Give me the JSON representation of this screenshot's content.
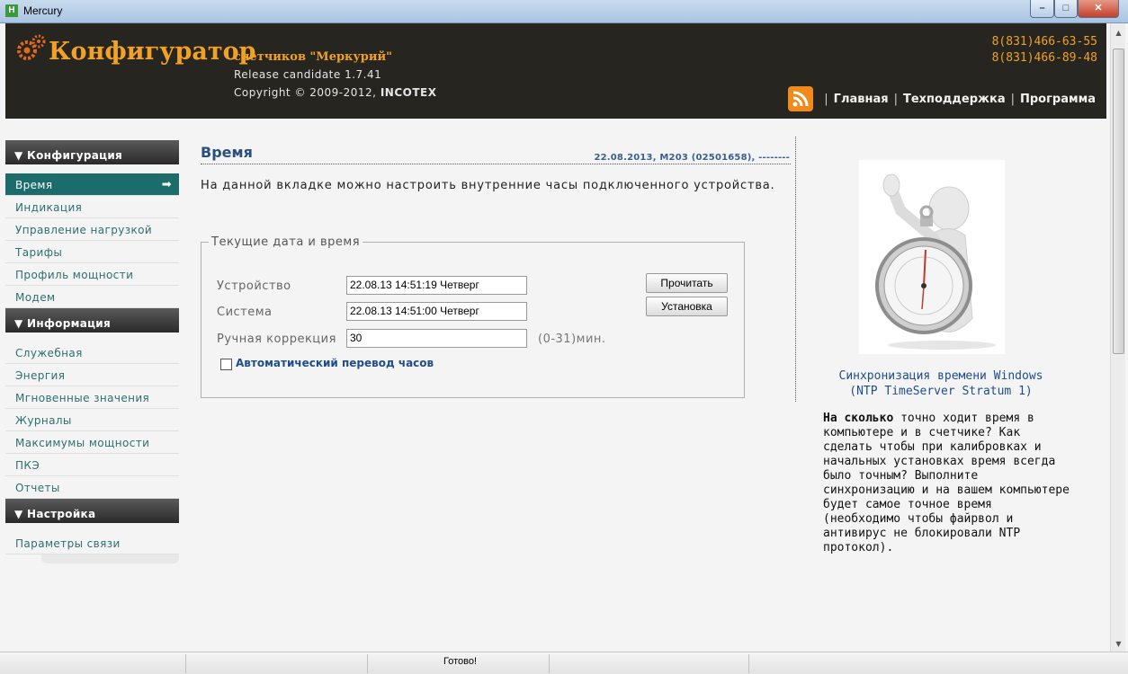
{
  "window": {
    "title": "Mercury",
    "icon_letter": "H",
    "minimize": "–",
    "maximize": "□",
    "close": "✕"
  },
  "header": {
    "logo_title": "Конфигуратор",
    "logo_subtitle": "счетчиков \"Меркурий\"",
    "release": "Release candidate 1.7.41",
    "copyright_prefix": "Copyright © 2009-2012, ",
    "copyright_company": "INCOTEX",
    "phones": [
      "8(831)466-63-55",
      "8(831)466-89-48"
    ],
    "nav": [
      "Главная",
      "Техподдержка",
      "Программа"
    ],
    "separator": "|"
  },
  "sidebar": {
    "sections": [
      {
        "title": "▼ Конфигурация",
        "items": [
          "Время",
          "Индикация",
          "Управление нагрузкой",
          "Тарифы",
          "Профиль мощности",
          "Модем"
        ]
      },
      {
        "title": "▼ Информация",
        "items": [
          "Служебная",
          "Энергия",
          "Мгновенные значения",
          "Журналы",
          "Максимумы мощности",
          "ПКЭ",
          "Отчеты"
        ]
      },
      {
        "title": "▼ Настройка",
        "items": [
          "Параметры связи"
        ]
      }
    ],
    "active_arrow": "➡"
  },
  "main": {
    "title": "Время",
    "date_info": "22.08.2013, M203 (02501658), --------",
    "description": "На данной вкладке можно настроить внутренние часы подключенного устройства.",
    "fieldset_legend": "Текущие дата и время",
    "device_label": "Устройство",
    "device_value": "22.08.13  14:51:19  Четверг",
    "system_label": "Система",
    "system_value": "22.08.13  14:51:00  Четверг",
    "manual_label": "Ручная коррекция",
    "manual_value": "30",
    "manual_range": "(0-31)мин.",
    "read_button": "Прочитать",
    "set_button": "Установка",
    "auto_dst_label": "Автоматический перевод часов",
    "auto_dst_checked": false
  },
  "right_panel": {
    "link_line1": "Синхронизация времени Windows",
    "link_line2": "(NTP TimeServer Stratum 1)",
    "text_bold": "На сколько",
    "text_rest": " точно ходит время в компьютере и в счетчике? Как сделать чтобы при калибровках и начальных установках время всегда было точным? Выполните синхронизацию и на вашем компьютере будет самое точное время (необходимо чтобы файрвол и антивирус не блокировали NTP протокол)."
  },
  "status_bar": {
    "text": "Готово!"
  },
  "colors": {
    "header_bg": "#272520",
    "accent_orange": "#f0a126",
    "active_item": "#1c6c6c",
    "link_blue": "#1f4d8a"
  }
}
